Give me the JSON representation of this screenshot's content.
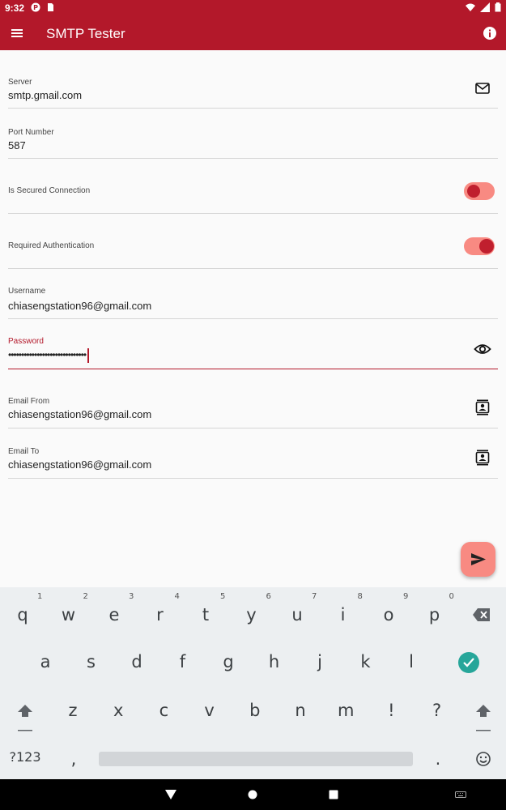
{
  "status_bar": {
    "time": "9:32"
  },
  "app_bar": {
    "title": "SMTP Tester",
    "menu_icon": "menu-icon",
    "info_icon": "info-icon"
  },
  "fields": {
    "server": {
      "label": "Server",
      "value": "smtp.gmail.com",
      "icon": "mail-icon"
    },
    "port": {
      "label": "Port Number",
      "value": "587"
    },
    "secured": {
      "label": "Is Secured Connection",
      "on": false
    },
    "auth": {
      "label": "Required Authentication",
      "on": true
    },
    "username": {
      "label": "Username",
      "value": "chiasengstation96@gmail.com"
    },
    "password": {
      "label": "Password",
      "value": "••••••••••••••••••••••••••••••",
      "icon": "eye-icon"
    },
    "email_from": {
      "label": "Email From",
      "value": "chiasengstation96@gmail.com",
      "icon": "contacts-icon"
    },
    "email_to": {
      "label": "Email To",
      "value": "chiasengstation96@gmail.com",
      "icon": "contacts-icon"
    }
  },
  "fab": {
    "icon": "send-icon"
  },
  "keyboard": {
    "row1": [
      "q",
      "w",
      "e",
      "r",
      "t",
      "y",
      "u",
      "i",
      "o",
      "p"
    ],
    "row1_hints": [
      "1",
      "2",
      "3",
      "4",
      "5",
      "6",
      "7",
      "8",
      "9",
      "0"
    ],
    "row2": [
      "a",
      "s",
      "d",
      "f",
      "g",
      "h",
      "j",
      "k",
      "l"
    ],
    "row3": [
      "z",
      "x",
      "c",
      "v",
      "b",
      "n",
      "m",
      "!",
      "?"
    ],
    "symbols_label": "?123",
    "comma": ",",
    "period": "."
  },
  "colors": {
    "primary": "#b3182a",
    "accent_light": "#f88a82",
    "accent_dark": "#c01f2e",
    "enter_key": "#26a69a"
  }
}
